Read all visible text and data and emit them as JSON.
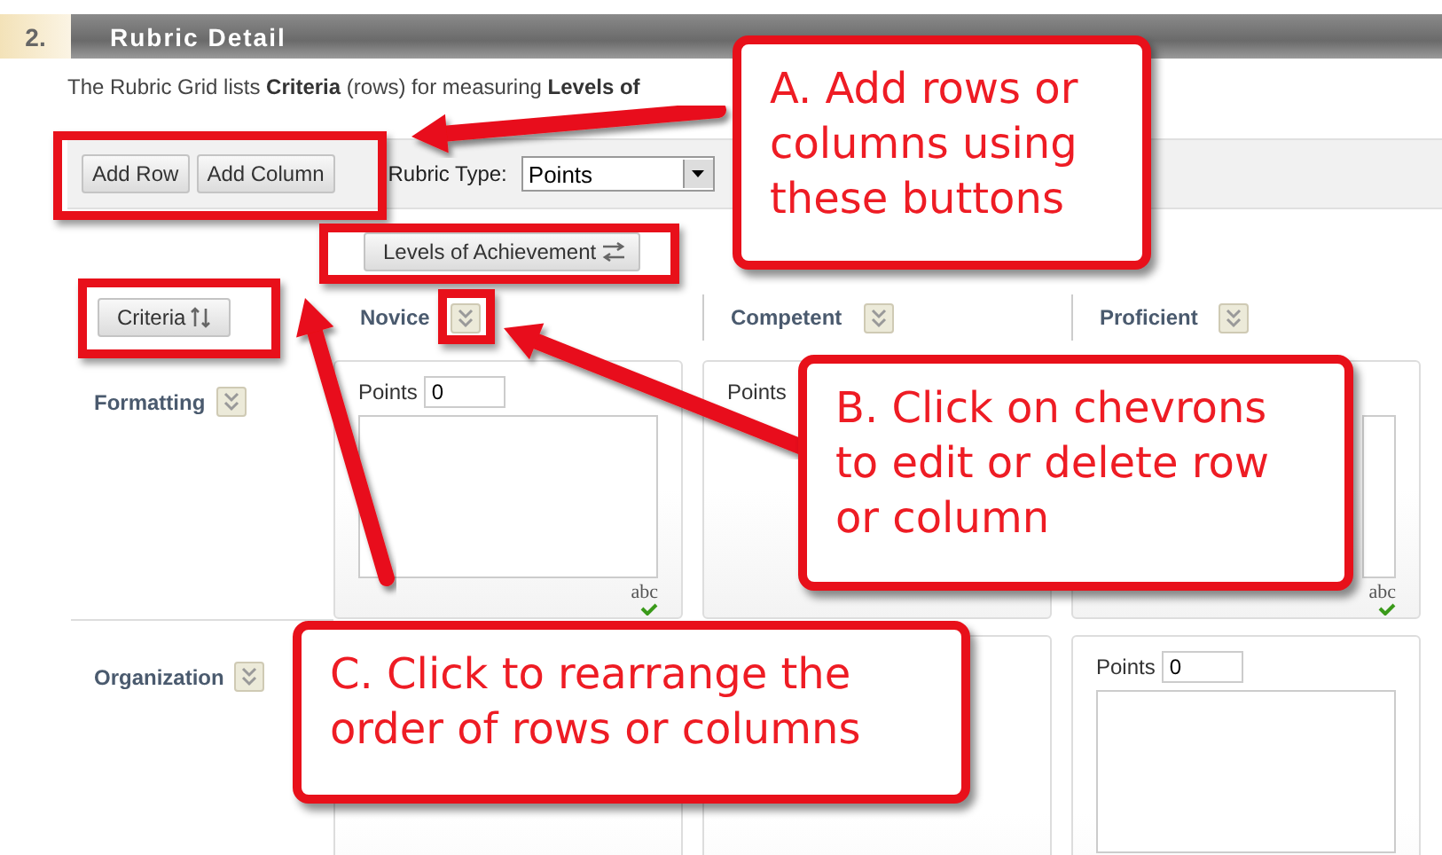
{
  "section": {
    "number": "2.",
    "title": "Rubric Detail"
  },
  "intro": "The Rubric Grid lists **Criteria** (rows) for measuring **Levels of**",
  "toolbar": {
    "buttons": [
      "Add Row",
      "Add Column"
    ],
    "rubric_type_label": "Rubric Type:",
    "rubric_type_value": "Points"
  },
  "levels_button": "Levels of Achievement",
  "criteria_button": "Criteria",
  "columns": [
    "Novice",
    "Competent",
    "Proficient"
  ],
  "rows": [
    {
      "name": "Formatting",
      "cells": [
        {
          "points_label": "Points",
          "points": "0",
          "spellcheck_label": "abc"
        },
        {
          "points_label": "Points"
        },
        {
          "spellcheck_label": "abc"
        }
      ]
    },
    {
      "name": "Organization",
      "cells": [
        {},
        {},
        {
          "points_label": "Points",
          "points": "0"
        }
      ]
    }
  ],
  "callouts": [
    {
      "text": "A. Add rows or columns using these buttons"
    },
    {
      "text": "B. Click on chevrons to edit or delete row or column"
    },
    {
      "text": "C. Click to rearrange the order of rows or columns"
    }
  ]
}
